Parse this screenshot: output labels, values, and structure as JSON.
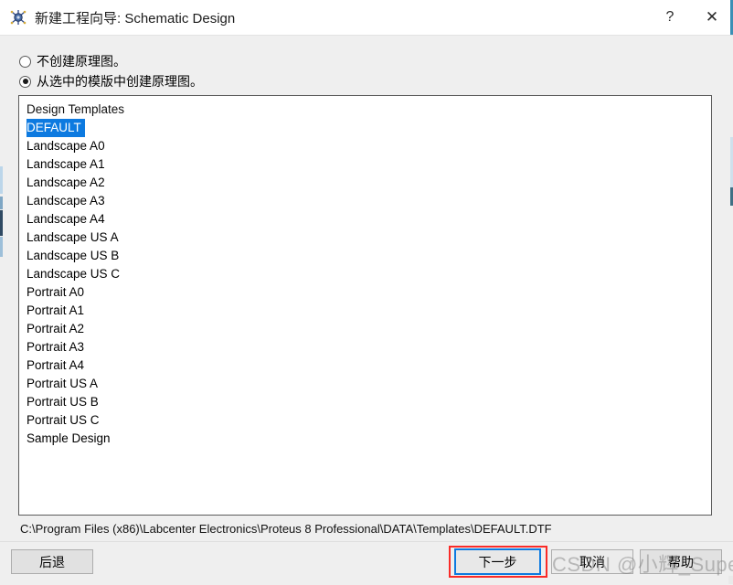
{
  "window": {
    "title": "新建工程向导: Schematic Design",
    "icon": "proteus-app-icon",
    "help_button": "?",
    "close_button": "✕"
  },
  "options": [
    {
      "label": "不创建原理图。",
      "selected": false
    },
    {
      "label": "从选中的模版中创建原理图。",
      "selected": true
    }
  ],
  "template_list": {
    "header": "Design Templates",
    "selected": "DEFAULT",
    "items": [
      "DEFAULT",
      "Landscape A0",
      "Landscape A1",
      "Landscape A2",
      "Landscape A3",
      "Landscape A4",
      "Landscape US A",
      "Landscape US B",
      "Landscape US C",
      "Portrait A0",
      "Portrait A1",
      "Portrait A2",
      "Portrait A3",
      "Portrait A4",
      "Portrait US A",
      "Portrait US B",
      "Portrait US C",
      "Sample Design"
    ]
  },
  "path": "C:\\Program Files (x86)\\Labcenter Electronics\\Proteus 8 Professional\\DATA\\Templates\\DEFAULT.DTF",
  "buttons": {
    "back": "后退",
    "next": "下一步",
    "cancel": "取消",
    "help": "帮助"
  },
  "annotation": {
    "highlight_color": "#fa2b28",
    "focus_color": "#0d7ae0"
  },
  "watermark": "CSDN @小辉_Super"
}
